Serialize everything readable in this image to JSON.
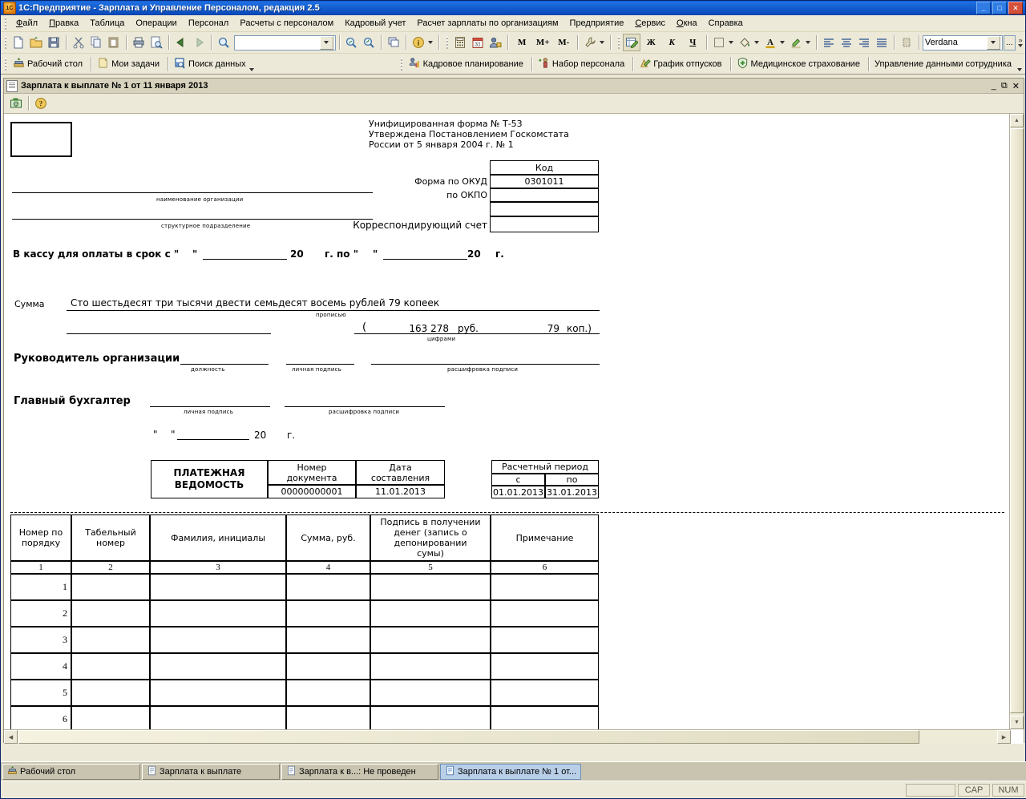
{
  "window": {
    "title": "1С:Предприятие - Зарплата и Управление Персоналом, редакция 2.5",
    "app_icon": "1c-logo-icon",
    "minimize": "_",
    "maximize": "□",
    "close": "✕"
  },
  "menubar": [
    {
      "label": "Файл",
      "accel": "Ф"
    },
    {
      "label": "Правка",
      "accel": "П"
    },
    {
      "label": "Таблица"
    },
    {
      "label": "Операции"
    },
    {
      "label": "Персонал"
    },
    {
      "label": "Расчеты с персоналом"
    },
    {
      "label": "Кадровый учет"
    },
    {
      "label": "Расчет зарплаты по организациям"
    },
    {
      "label": "Предприятие"
    },
    {
      "label": "Сервис",
      "accel": "С"
    },
    {
      "label": "Окна",
      "accel": "О"
    },
    {
      "label": "Справка"
    }
  ],
  "toolbar_main": {
    "buttons": [
      {
        "name": "new-document-icon"
      },
      {
        "name": "open-folder-icon"
      },
      {
        "name": "save-icon"
      },
      {
        "name": "cut-icon"
      },
      {
        "name": "copy-icon"
      },
      {
        "name": "paste-icon"
      },
      {
        "name": "print-icon"
      },
      {
        "name": "print-preview-icon"
      },
      {
        "name": "undo-arrow-icon"
      },
      {
        "name": "redo-arrow-icon"
      },
      {
        "name": "find-icon"
      }
    ],
    "search_value": "",
    "search_placeholder": "",
    "buttons2": [
      {
        "name": "zoom-in-icon"
      },
      {
        "name": "zoom-out-icon"
      },
      {
        "name": "windows-cascade-icon"
      },
      {
        "name": "info-icon"
      },
      {
        "name": "calculator-icon"
      },
      {
        "name": "calendar-icon"
      },
      {
        "name": "user-lock-icon"
      }
    ],
    "memory_buttons": [
      "M",
      "M+",
      "M-"
    ],
    "settings_icon": "wrench-icon",
    "format_buttons": [
      {
        "name": "edit-cell-icon",
        "active": true
      },
      {
        "name": "bold-icon",
        "label": "Ж"
      },
      {
        "name": "italic-icon",
        "label": "К"
      },
      {
        "name": "underline-icon",
        "label": "Ч"
      },
      {
        "name": "borders-icon"
      },
      {
        "name": "fill-color-icon"
      },
      {
        "name": "font-color-icon"
      },
      {
        "name": "highlight-color-icon"
      },
      {
        "name": "align-left-icon"
      },
      {
        "name": "align-center-icon"
      },
      {
        "name": "align-right-icon"
      },
      {
        "name": "align-justify-icon"
      },
      {
        "name": "cell-properties-icon"
      }
    ],
    "font_name": "Verdana",
    "font_more": "...",
    "overflow": "»"
  },
  "toolbar_nav": {
    "left_items": [
      {
        "label": "Рабочий стол",
        "icon": "desktop-icon"
      },
      {
        "label": "Мои задачи",
        "icon": "tasks-icon"
      },
      {
        "label": "Поиск данных",
        "icon": "data-search-icon"
      }
    ],
    "right_items": [
      {
        "label": "Кадровое планирование",
        "icon": "hr-planning-icon"
      },
      {
        "label": "Набор персонала",
        "icon": "recruiting-icon"
      },
      {
        "label": "График отпусков",
        "icon": "vacation-schedule-icon"
      },
      {
        "label": "Медицинское страхование",
        "icon": "medical-insurance-icon"
      },
      {
        "label": "Управление данными сотрудника",
        "icon": "employee-data-icon"
      }
    ]
  },
  "child_window": {
    "title": "Зарплата к выплате № 1 от 11 января 2013",
    "icon": "document-icon",
    "minimize": "_",
    "maximize": "⧉",
    "close": "✕",
    "tools": [
      {
        "name": "print-report-icon"
      },
      {
        "name": "help-icon"
      }
    ]
  },
  "document": {
    "form_header": [
      "Унифицированная форма № Т-53",
      "Утверждена Постановлением Госкомстата",
      "России от 5 января 2004 г. № 1"
    ],
    "code_table": {
      "header": "Код",
      "rows": [
        {
          "label": "Форма по ОКУД",
          "value": "0301011"
        },
        {
          "label": "по ОКПО",
          "value": ""
        },
        {
          "label": "",
          "value": ""
        },
        {
          "label": "Корреспондирующий счет",
          "value": ""
        }
      ]
    },
    "org_caption": "наименование организации",
    "subdivision_caption": "структурное подразделение",
    "cashier_line": {
      "prefix": "В кассу для оплаты в срок с \"",
      "quote": "\"",
      "year1": "20",
      "mid": "г. по \"",
      "year2": "20",
      "suffix": "г."
    },
    "amount": {
      "label": "Сумма",
      "in_words": "Сто шестьдесят три тысячи двести семьдесят восемь рублей 79 копеек",
      "words_caption": "прописью",
      "open_paren": "(",
      "rub_value": "163 278",
      "rub_label": "руб.",
      "kop_value": "79",
      "kop_label": "коп.)",
      "figures_caption": "цифрами"
    },
    "signatures": [
      {
        "title": "Руководитель организации",
        "captions": [
          "должность",
          "личная подпись",
          "расшифровка подписи"
        ]
      },
      {
        "title": "Главный бухгалтер",
        "captions": [
          "личная подпись",
          "расшифровка подписи"
        ]
      }
    ],
    "date_line": {
      "q1": "\"",
      "q2": "\"",
      "year": "20",
      "suffix": "г."
    },
    "statement": {
      "title_line1": "ПЛАТЕЖНАЯ",
      "title_line2": "ВЕДОМОСТЬ",
      "doc_number_label_l1": "Номер",
      "doc_number_label_l2": "документа",
      "doc_date_label_l1": "Дата",
      "doc_date_label_l2": "составления",
      "doc_number": "00000000001",
      "doc_date": "11.01.2013"
    },
    "period": {
      "title": "Расчетный период",
      "from_label": "с",
      "to_label": "по",
      "from": "01.01.2013",
      "to": "31.01.2013"
    },
    "table": {
      "headers": [
        "Номер по порядку",
        "Табельный номер",
        "Фамилия, инициалы",
        "Сумма, руб.",
        "Подпись в получении денег (запись о депонировании суммы)",
        "Примечание"
      ],
      "numbering": [
        "1",
        "2",
        "3",
        "4",
        "5",
        "6"
      ],
      "rows": [
        {
          "no": "1",
          "tab": "",
          "name": "",
          "sum": "",
          "sign": "",
          "note": ""
        },
        {
          "no": "2",
          "tab": "",
          "name": "",
          "sum": "",
          "sign": "",
          "note": ""
        },
        {
          "no": "3",
          "tab": "",
          "name": "",
          "sum": "",
          "sign": "",
          "note": ""
        },
        {
          "no": "4",
          "tab": "",
          "name": "",
          "sum": "",
          "sign": "",
          "note": ""
        },
        {
          "no": "5",
          "tab": "",
          "name": "",
          "sum": "",
          "sign": "",
          "note": ""
        },
        {
          "no": "6",
          "tab": "",
          "name": "",
          "sum": "",
          "sign": "",
          "note": ""
        }
      ]
    }
  },
  "taskbar": [
    {
      "label": "Рабочий стол",
      "icon": "desktop-icon",
      "active": false
    },
    {
      "label": "Зарплата к выплате",
      "icon": "document-icon",
      "active": false
    },
    {
      "label": "Зарплата к в...: Не проведен",
      "icon": "document-icon",
      "active": false
    },
    {
      "label": "Зарплата к выплате № 1 от...",
      "icon": "document-icon",
      "active": true
    }
  ],
  "statusbar": {
    "message": "",
    "caps": "CAP",
    "num": "NUM"
  }
}
